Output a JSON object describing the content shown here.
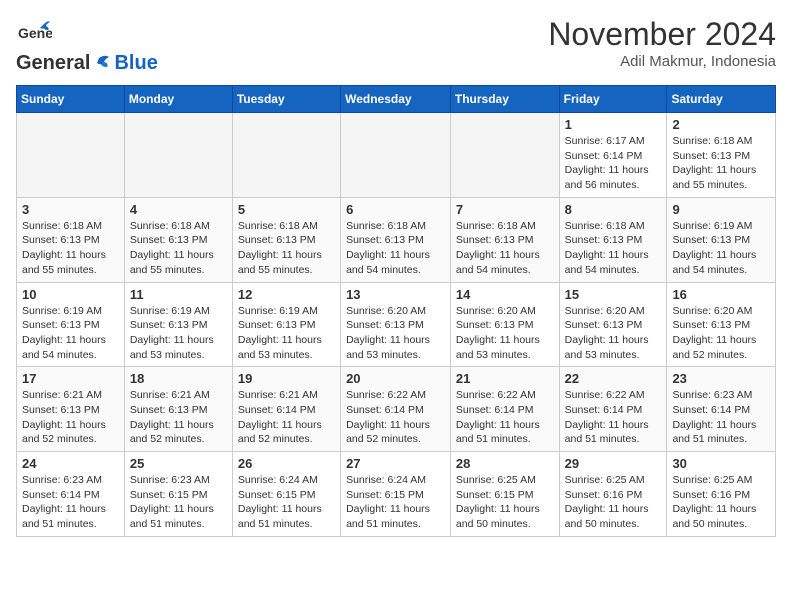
{
  "header": {
    "logo_general": "General",
    "logo_blue": "Blue",
    "month": "November 2024",
    "location": "Adil Makmur, Indonesia"
  },
  "weekdays": [
    "Sunday",
    "Monday",
    "Tuesday",
    "Wednesday",
    "Thursday",
    "Friday",
    "Saturday"
  ],
  "weeks": [
    [
      {
        "day": "",
        "empty": true
      },
      {
        "day": "",
        "empty": true
      },
      {
        "day": "",
        "empty": true
      },
      {
        "day": "",
        "empty": true
      },
      {
        "day": "",
        "empty": true
      },
      {
        "day": "1",
        "sunrise": "Sunrise: 6:17 AM",
        "sunset": "Sunset: 6:14 PM",
        "daylight": "Daylight: 11 hours and 56 minutes."
      },
      {
        "day": "2",
        "sunrise": "Sunrise: 6:18 AM",
        "sunset": "Sunset: 6:13 PM",
        "daylight": "Daylight: 11 hours and 55 minutes."
      }
    ],
    [
      {
        "day": "3",
        "sunrise": "Sunrise: 6:18 AM",
        "sunset": "Sunset: 6:13 PM",
        "daylight": "Daylight: 11 hours and 55 minutes."
      },
      {
        "day": "4",
        "sunrise": "Sunrise: 6:18 AM",
        "sunset": "Sunset: 6:13 PM",
        "daylight": "Daylight: 11 hours and 55 minutes."
      },
      {
        "day": "5",
        "sunrise": "Sunrise: 6:18 AM",
        "sunset": "Sunset: 6:13 PM",
        "daylight": "Daylight: 11 hours and 55 minutes."
      },
      {
        "day": "6",
        "sunrise": "Sunrise: 6:18 AM",
        "sunset": "Sunset: 6:13 PM",
        "daylight": "Daylight: 11 hours and 54 minutes."
      },
      {
        "day": "7",
        "sunrise": "Sunrise: 6:18 AM",
        "sunset": "Sunset: 6:13 PM",
        "daylight": "Daylight: 11 hours and 54 minutes."
      },
      {
        "day": "8",
        "sunrise": "Sunrise: 6:18 AM",
        "sunset": "Sunset: 6:13 PM",
        "daylight": "Daylight: 11 hours and 54 minutes."
      },
      {
        "day": "9",
        "sunrise": "Sunrise: 6:19 AM",
        "sunset": "Sunset: 6:13 PM",
        "daylight": "Daylight: 11 hours and 54 minutes."
      }
    ],
    [
      {
        "day": "10",
        "sunrise": "Sunrise: 6:19 AM",
        "sunset": "Sunset: 6:13 PM",
        "daylight": "Daylight: 11 hours and 54 minutes."
      },
      {
        "day": "11",
        "sunrise": "Sunrise: 6:19 AM",
        "sunset": "Sunset: 6:13 PM",
        "daylight": "Daylight: 11 hours and 53 minutes."
      },
      {
        "day": "12",
        "sunrise": "Sunrise: 6:19 AM",
        "sunset": "Sunset: 6:13 PM",
        "daylight": "Daylight: 11 hours and 53 minutes."
      },
      {
        "day": "13",
        "sunrise": "Sunrise: 6:20 AM",
        "sunset": "Sunset: 6:13 PM",
        "daylight": "Daylight: 11 hours and 53 minutes."
      },
      {
        "day": "14",
        "sunrise": "Sunrise: 6:20 AM",
        "sunset": "Sunset: 6:13 PM",
        "daylight": "Daylight: 11 hours and 53 minutes."
      },
      {
        "day": "15",
        "sunrise": "Sunrise: 6:20 AM",
        "sunset": "Sunset: 6:13 PM",
        "daylight": "Daylight: 11 hours and 53 minutes."
      },
      {
        "day": "16",
        "sunrise": "Sunrise: 6:20 AM",
        "sunset": "Sunset: 6:13 PM",
        "daylight": "Daylight: 11 hours and 52 minutes."
      }
    ],
    [
      {
        "day": "17",
        "sunrise": "Sunrise: 6:21 AM",
        "sunset": "Sunset: 6:13 PM",
        "daylight": "Daylight: 11 hours and 52 minutes."
      },
      {
        "day": "18",
        "sunrise": "Sunrise: 6:21 AM",
        "sunset": "Sunset: 6:13 PM",
        "daylight": "Daylight: 11 hours and 52 minutes."
      },
      {
        "day": "19",
        "sunrise": "Sunrise: 6:21 AM",
        "sunset": "Sunset: 6:14 PM",
        "daylight": "Daylight: 11 hours and 52 minutes."
      },
      {
        "day": "20",
        "sunrise": "Sunrise: 6:22 AM",
        "sunset": "Sunset: 6:14 PM",
        "daylight": "Daylight: 11 hours and 52 minutes."
      },
      {
        "day": "21",
        "sunrise": "Sunrise: 6:22 AM",
        "sunset": "Sunset: 6:14 PM",
        "daylight": "Daylight: 11 hours and 51 minutes."
      },
      {
        "day": "22",
        "sunrise": "Sunrise: 6:22 AM",
        "sunset": "Sunset: 6:14 PM",
        "daylight": "Daylight: 11 hours and 51 minutes."
      },
      {
        "day": "23",
        "sunrise": "Sunrise: 6:23 AM",
        "sunset": "Sunset: 6:14 PM",
        "daylight": "Daylight: 11 hours and 51 minutes."
      }
    ],
    [
      {
        "day": "24",
        "sunrise": "Sunrise: 6:23 AM",
        "sunset": "Sunset: 6:14 PM",
        "daylight": "Daylight: 11 hours and 51 minutes."
      },
      {
        "day": "25",
        "sunrise": "Sunrise: 6:23 AM",
        "sunset": "Sunset: 6:15 PM",
        "daylight": "Daylight: 11 hours and 51 minutes."
      },
      {
        "day": "26",
        "sunrise": "Sunrise: 6:24 AM",
        "sunset": "Sunset: 6:15 PM",
        "daylight": "Daylight: 11 hours and 51 minutes."
      },
      {
        "day": "27",
        "sunrise": "Sunrise: 6:24 AM",
        "sunset": "Sunset: 6:15 PM",
        "daylight": "Daylight: 11 hours and 51 minutes."
      },
      {
        "day": "28",
        "sunrise": "Sunrise: 6:25 AM",
        "sunset": "Sunset: 6:15 PM",
        "daylight": "Daylight: 11 hours and 50 minutes."
      },
      {
        "day": "29",
        "sunrise": "Sunrise: 6:25 AM",
        "sunset": "Sunset: 6:16 PM",
        "daylight": "Daylight: 11 hours and 50 minutes."
      },
      {
        "day": "30",
        "sunrise": "Sunrise: 6:25 AM",
        "sunset": "Sunset: 6:16 PM",
        "daylight": "Daylight: 11 hours and 50 minutes."
      }
    ]
  ]
}
